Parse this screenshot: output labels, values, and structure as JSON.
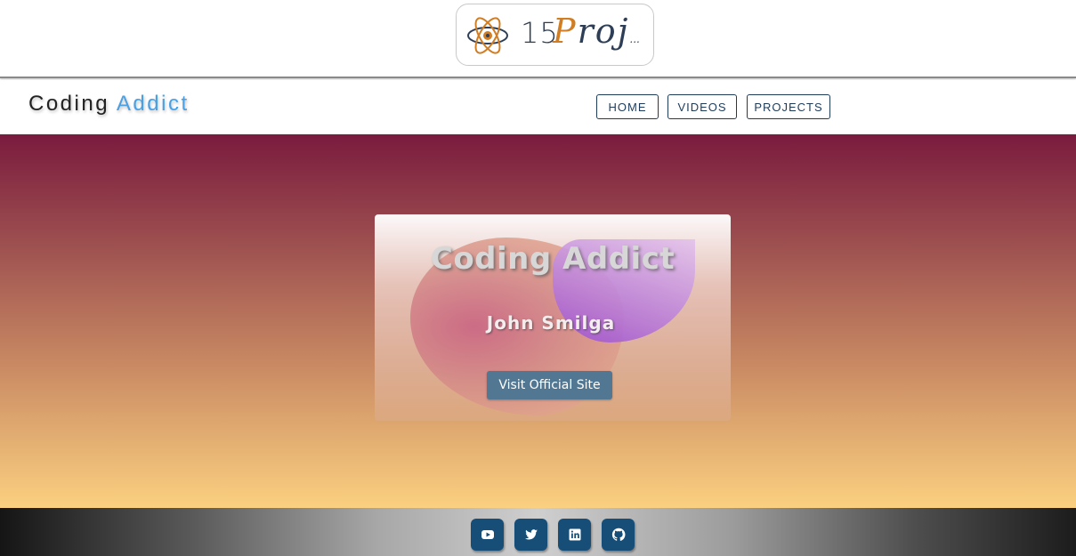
{
  "logo": {
    "number": "15",
    "word_first": "P",
    "word_rest": "roj",
    "ellipsis": "..."
  },
  "navbar": {
    "brand_first": "Coding",
    "brand_accent": "Addict",
    "links": [
      {
        "label": "HOME"
      },
      {
        "label": "VIDEOS"
      },
      {
        "label": "PROJECTS"
      }
    ]
  },
  "hero": {
    "title": "Coding Addict",
    "subtitle": "John Smilga",
    "button_label": "Visit Official Site"
  },
  "footer": {
    "icons": [
      "youtube-icon",
      "twitter-icon",
      "linkedin-icon",
      "github-icon"
    ]
  },
  "colors": {
    "accent": "#4aa0e3",
    "nav_border": "#1e3c5a",
    "button": "#527792",
    "social": "#164e78"
  }
}
